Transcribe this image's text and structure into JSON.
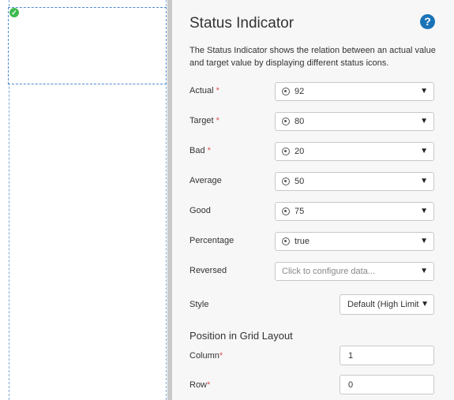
{
  "panel": {
    "title": "Status Indicator",
    "help_icon": "help-icon",
    "description": "The Status Indicator shows the relation between an actual value and target value by displaying different status icons."
  },
  "fields": [
    {
      "label": "Actual",
      "required": true,
      "value": "92"
    },
    {
      "label": "Target",
      "required": true,
      "value": "80"
    },
    {
      "label": "Bad",
      "required": true,
      "value": "20"
    },
    {
      "label": "Average",
      "required": false,
      "value": "50"
    },
    {
      "label": "Good",
      "required": false,
      "value": "75"
    },
    {
      "label": "Percentage",
      "required": false,
      "value": "true"
    }
  ],
  "reversed": {
    "label": "Reversed",
    "placeholder": "Click to configure data..."
  },
  "style": {
    "label": "Style",
    "value": "Default (High Limit"
  },
  "grid": {
    "title": "Position in Grid Layout",
    "column": {
      "label": "Column",
      "value": "1"
    },
    "row": {
      "label": "Row",
      "value": "0"
    }
  },
  "required_mark": "*",
  "colors": {
    "accent": "#1a73b7",
    "required": "#d9534f",
    "selection": "#4a8bd0",
    "check": "#3fb950"
  }
}
